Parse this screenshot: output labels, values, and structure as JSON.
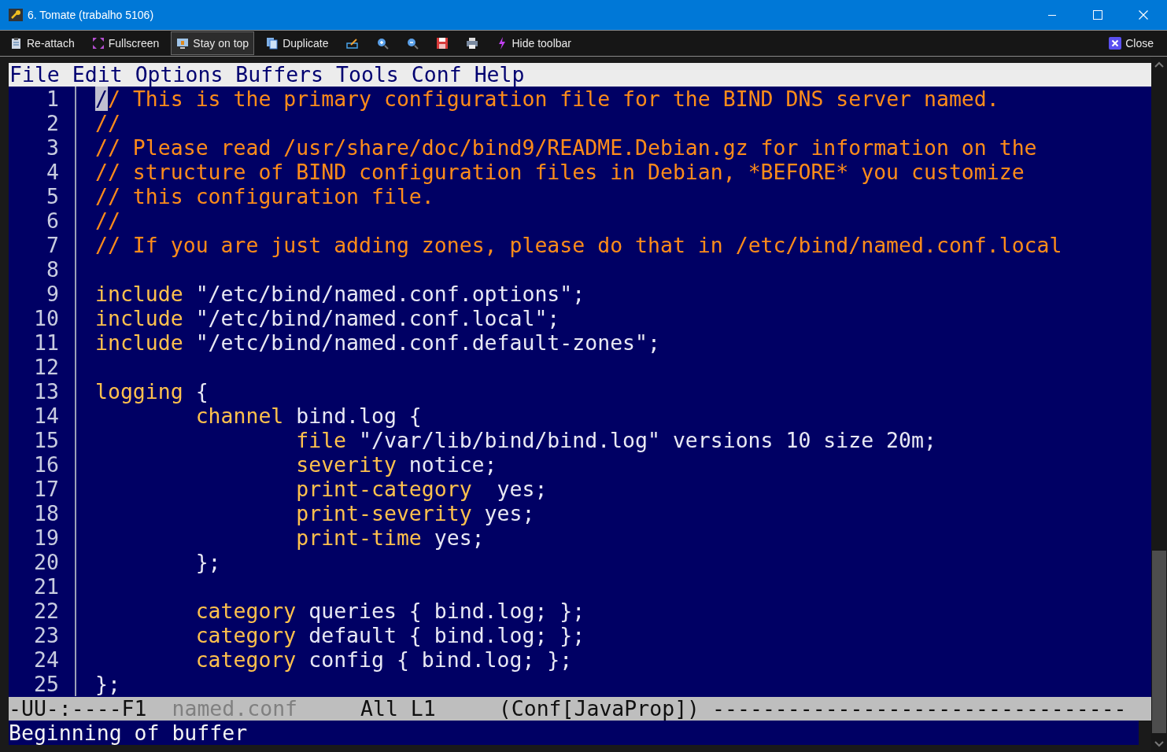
{
  "window": {
    "title": "6. Tomate (trabalho 5106)"
  },
  "toolbar": [
    {
      "label": "Re-attach",
      "selected": false
    },
    {
      "label": "Fullscreen",
      "selected": false
    },
    {
      "label": "Stay on top",
      "selected": true
    },
    {
      "label": "Duplicate",
      "selected": false
    },
    {
      "selected": false
    },
    {
      "selected": false
    },
    {
      "selected": false
    },
    {
      "selected": false
    },
    {
      "selected": false
    },
    {
      "label": "Hide toolbar",
      "selected": false
    }
  ],
  "close_button": {
    "label": "Close"
  },
  "menu_bar": [
    "File",
    "Edit",
    "Options",
    "Buffers",
    "Tools",
    "Conf",
    "Help"
  ],
  "lines": [
    {
      "number": "1",
      "segments": [
        {
          "kind": "cursor",
          "text": "/"
        },
        {
          "kind": "comment",
          "text": "/ This is the primary configuration file for the BIND DNS server named."
        }
      ]
    },
    {
      "number": "2",
      "segments": [
        {
          "kind": "comment",
          "text": "//"
        }
      ]
    },
    {
      "number": "3",
      "segments": [
        {
          "kind": "comment",
          "text": "// Please read /usr/share/doc/bind9/README.Debian.gz for information on the"
        }
      ]
    },
    {
      "number": "4",
      "segments": [
        {
          "kind": "comment",
          "text": "// structure of BIND configuration files in Debian, *BEFORE* you customize"
        }
      ]
    },
    {
      "number": "5",
      "segments": [
        {
          "kind": "comment",
          "text": "// this configuration file."
        }
      ]
    },
    {
      "number": "6",
      "segments": [
        {
          "kind": "comment",
          "text": "//"
        }
      ]
    },
    {
      "number": "7",
      "segments": [
        {
          "kind": "comment",
          "text": "// If you are just adding zones, please do that in /etc/bind/named.conf.local"
        }
      ]
    },
    {
      "number": "8"
    },
    {
      "number": "9",
      "segments": [
        {
          "kind": "keyword",
          "text": "include"
        },
        {
          "kind": "plain",
          "text": " \"/etc/bind/named.conf.options\";"
        }
      ]
    },
    {
      "number": "10",
      "segments": [
        {
          "kind": "keyword",
          "text": "include"
        },
        {
          "kind": "plain",
          "text": " \"/etc/bind/named.conf.local\";"
        }
      ]
    },
    {
      "number": "11",
      "segments": [
        {
          "kind": "keyword",
          "text": "include"
        },
        {
          "kind": "plain",
          "text": " \"/etc/bind/named.conf.default-zones\";"
        }
      ]
    },
    {
      "number": "12"
    },
    {
      "number": "13",
      "segments": [
        {
          "kind": "keyword",
          "text": "logging"
        },
        {
          "kind": "plain",
          "text": " {"
        }
      ]
    },
    {
      "number": "14",
      "segments": [
        {
          "kind": "tab"
        },
        {
          "kind": "keyword",
          "text": "channel"
        },
        {
          "kind": "plain",
          "text": " bind.log {"
        }
      ]
    },
    {
      "number": "15",
      "segments": [
        {
          "kind": "tab"
        },
        {
          "kind": "tab"
        },
        {
          "kind": "keyword",
          "text": "file"
        },
        {
          "kind": "plain",
          "text": " \"/var/lib/bind/bind.log\" versions 10 size 20m;"
        }
      ]
    },
    {
      "number": "16",
      "segments": [
        {
          "kind": "tab"
        },
        {
          "kind": "tab"
        },
        {
          "kind": "keyword",
          "text": "severity"
        },
        {
          "kind": "plain",
          "text": " notice;"
        }
      ]
    },
    {
      "number": "17",
      "segments": [
        {
          "kind": "tab"
        },
        {
          "kind": "tab"
        },
        {
          "kind": "keyword",
          "text": "print-category"
        },
        {
          "kind": "plain",
          "text": "  yes;"
        }
      ]
    },
    {
      "number": "18",
      "segments": [
        {
          "kind": "tab"
        },
        {
          "kind": "tab"
        },
        {
          "kind": "keyword",
          "text": "print-severity"
        },
        {
          "kind": "plain",
          "text": " yes;"
        }
      ]
    },
    {
      "number": "19",
      "segments": [
        {
          "kind": "tab"
        },
        {
          "kind": "tab"
        },
        {
          "kind": "keyword",
          "text": "print-time"
        },
        {
          "kind": "plain",
          "text": " yes;"
        }
      ]
    },
    {
      "number": "20",
      "segments": [
        {
          "kind": "tab"
        },
        {
          "kind": "plain",
          "text": "};"
        }
      ]
    },
    {
      "number": "21"
    },
    {
      "number": "22",
      "segments": [
        {
          "kind": "tab"
        },
        {
          "kind": "keyword",
          "text": "category"
        },
        {
          "kind": "plain",
          "text": " queries { bind.log; };"
        }
      ]
    },
    {
      "number": "23",
      "segments": [
        {
          "kind": "tab"
        },
        {
          "kind": "keyword",
          "text": "category"
        },
        {
          "kind": "plain",
          "text": " default { bind.log; };"
        }
      ]
    },
    {
      "number": "24",
      "segments": [
        {
          "kind": "tab"
        },
        {
          "kind": "keyword",
          "text": "category"
        },
        {
          "kind": "plain",
          "text": " config { bind.log; };"
        }
      ]
    },
    {
      "number": "25",
      "segments": [
        {
          "kind": "plain",
          "text": "};"
        }
      ]
    }
  ],
  "mode_line": {
    "status": "-UU-:----F1",
    "buffer_name": "named.conf",
    "position": "All L1",
    "mode": "(Conf[JavaProp])",
    "fill": "---------------------------------"
  },
  "echo_area": "Beginning of buffer"
}
